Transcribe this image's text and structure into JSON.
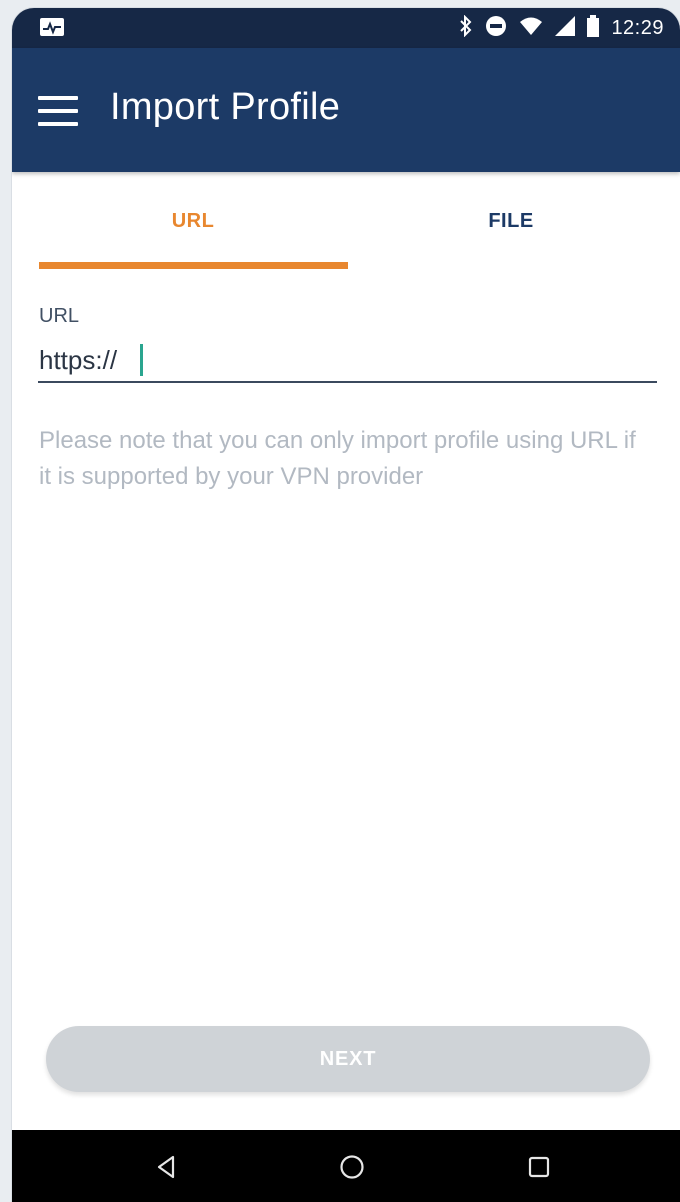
{
  "status_bar": {
    "time": "12:29",
    "icons": [
      "activity-icon",
      "bluetooth-icon",
      "do-not-disturb-icon",
      "wifi-icon",
      "signal-icon",
      "battery-icon"
    ]
  },
  "app_bar": {
    "title": "Import Profile",
    "menu_icon": "hamburger-menu-icon"
  },
  "tabs": [
    {
      "label": "URL",
      "selected": true
    },
    {
      "label": "FILE",
      "selected": false
    }
  ],
  "form": {
    "url_label": "URL",
    "url_value": "https://",
    "helper_text": "Please note that you can only import profile using URL if it is supported by your VPN provider"
  },
  "next_button": {
    "label": "NEXT",
    "enabled": false
  },
  "nav_bar": {
    "icons": [
      "back-icon",
      "home-icon",
      "recents-icon"
    ]
  },
  "colors": {
    "app_bar": "#1c3a66",
    "status_bar": "#162846",
    "accent": "#e8872f",
    "cursor": "#2aa58f",
    "disabled_button": "#cfd3d7"
  }
}
